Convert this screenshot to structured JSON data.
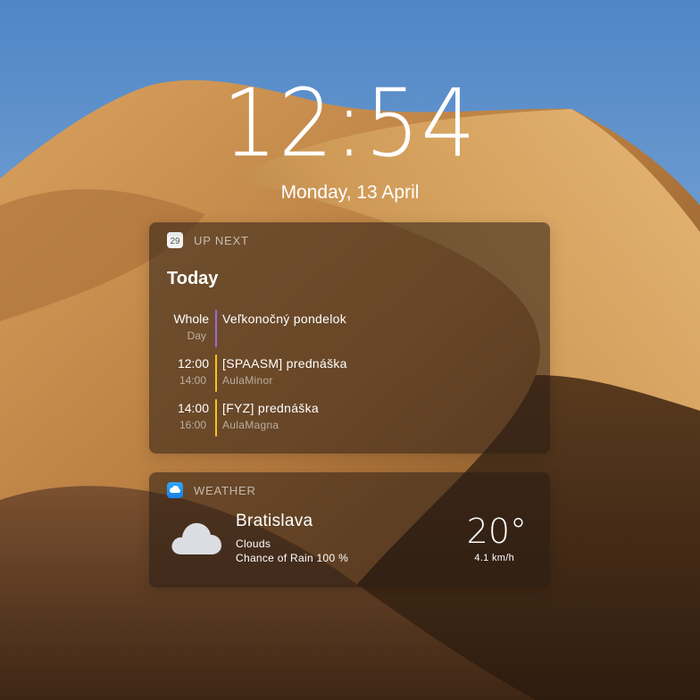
{
  "lockscreen": {
    "time": "12:54",
    "date": "Monday, 13 April"
  },
  "calendar_widget": {
    "header": "UP NEXT",
    "icon_day": "29",
    "icon": "calendar-icon",
    "day_title": "Today",
    "events": [
      {
        "start": "Whole",
        "end": "Day",
        "title": "Veľkonočný pondelok",
        "location": "",
        "color": "#9b6bde"
      },
      {
        "start": "12:00",
        "end": "14:00",
        "title": "[SPAASM] prednáška",
        "location": "AulaMinor",
        "color": "#f5c518"
      },
      {
        "start": "14:00",
        "end": "16:00",
        "title": "[FYZ] prednáška",
        "location": "AulaMagna",
        "color": "#f5c518"
      }
    ]
  },
  "weather_widget": {
    "header": "WEATHER",
    "icon": "weather-app-icon",
    "condition_icon": "cloud-icon",
    "city": "Bratislava",
    "condition": "Clouds",
    "rain": "Chance of Rain 100 %",
    "temperature": "20°",
    "wind": "4.1 km/h"
  }
}
